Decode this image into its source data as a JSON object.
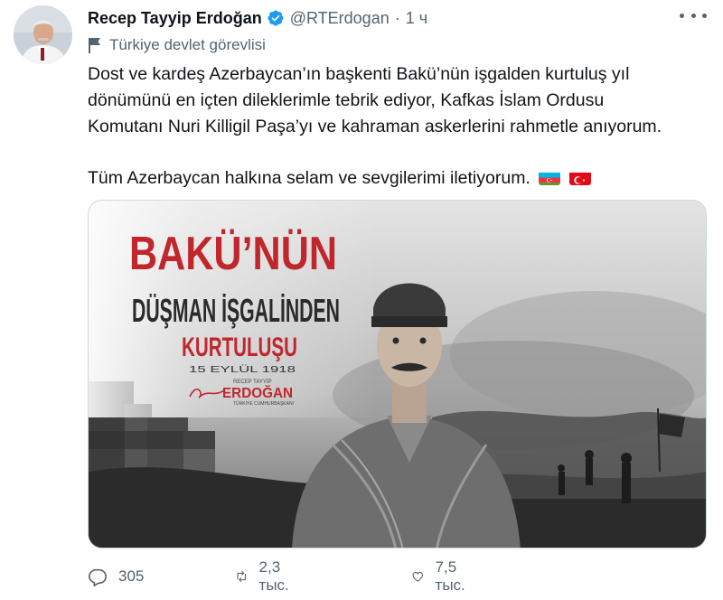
{
  "author": {
    "name": "Recep Tayyip Erdoğan",
    "handle": "@RTErdogan",
    "separator": "·",
    "time": "1 ч",
    "label": "Türkiye devlet görevlisi"
  },
  "tweet": {
    "lines": [
      "Dost ve kardeş Azerbaycan’ın başkenti Bakü’nün işgalden kurtuluş yıl",
      "dönümünü en içten dileklerimle tebrik ediyor, Kafkas İslam Ordusu",
      "Komutanı Nuri Killigil Paşa’yı ve kahraman askerlerini rahmetle anıyorum."
    ],
    "second_paragraph": "Tüm Azerbaycan halkına selam ve sevgilerimi iletiyorum."
  },
  "media": {
    "title_line1": "BAKÜ’NÜN",
    "title_line2": "DÜŞMAN İŞGALİNDEN",
    "title_line3": "KURTULUŞU",
    "date": "15 EYLÜL 1918",
    "sig_small": "RECEP TAYYİP",
    "sig_name": "ERDOĞAN",
    "sig_role": "TÜRKİYE CUMHURBAŞKANI"
  },
  "actions": {
    "replies": "305",
    "retweets": "2,3 тыс.",
    "likes": "7,5 тыс."
  },
  "colors": {
    "accent": "#1d9bf0",
    "muted": "#536471",
    "poster_red": "#c0272d"
  }
}
